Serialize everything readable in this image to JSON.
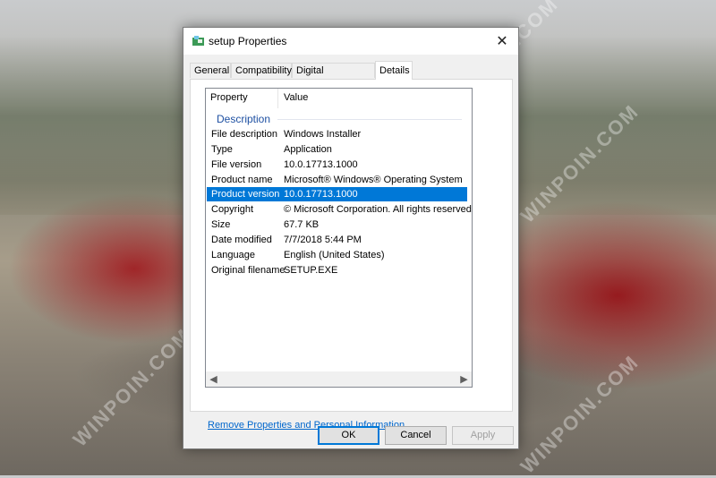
{
  "background": {
    "watermark": "WINPOIN.COM"
  },
  "window": {
    "title": "setup Properties",
    "close_glyph": "✕"
  },
  "tabs": [
    {
      "label": "General"
    },
    {
      "label": "Compatibility"
    },
    {
      "label": "Digital Signatures"
    },
    {
      "label": "Details",
      "active": true
    }
  ],
  "details": {
    "columns": [
      "Property",
      "Value"
    ],
    "group": "Description",
    "rows": [
      {
        "property": "File description",
        "value": "Windows Installer"
      },
      {
        "property": "Type",
        "value": "Application"
      },
      {
        "property": "File version",
        "value": "10.0.17713.1000"
      },
      {
        "property": "Product name",
        "value": "Microsoft® Windows® Operating System"
      },
      {
        "property": "Product version",
        "value": "10.0.17713.1000",
        "selected": true
      },
      {
        "property": "Copyright",
        "value": "© Microsoft Corporation. All rights reserved."
      },
      {
        "property": "Size",
        "value": "67.7 KB"
      },
      {
        "property": "Date modified",
        "value": "7/7/2018 5:44 PM"
      },
      {
        "property": "Language",
        "value": "English (United States)"
      },
      {
        "property": "Original filename",
        "value": "SETUP.EXE"
      }
    ]
  },
  "link": {
    "label": "Remove Properties and Personal Information"
  },
  "buttons": {
    "ok": "OK",
    "cancel": "Cancel",
    "apply": "Apply"
  },
  "colors": {
    "selection": "#0078d7",
    "group_header": "#1e50a2",
    "link": "#0066cc"
  }
}
